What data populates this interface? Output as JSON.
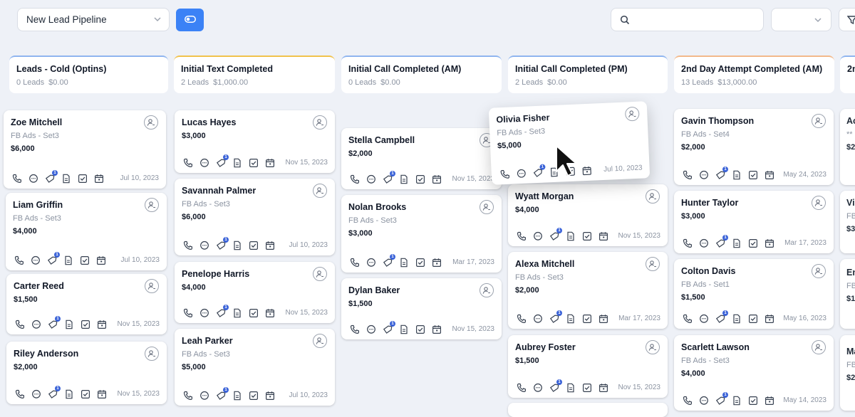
{
  "toolbar": {
    "pipeline_select": "New Lead Pipeline",
    "search_placeholder": "",
    "filter_select_value": ""
  },
  "colors": {
    "accent": "#3b82f6",
    "badge": "#3b63d8",
    "column_border": "#8fb5ef"
  },
  "columns": [
    {
      "title": "Leads - Cold (Optins)",
      "count": "0 Leads",
      "value": "$0.00"
    },
    {
      "title": "Initial Text Completed",
      "count": "2 Leads",
      "value": "$1,000.00"
    },
    {
      "title": "Initial Call Completed (AM)",
      "count": "0 Leads",
      "value": "$0.00"
    },
    {
      "title": "Initial Call Completed (PM)",
      "count": "2 Leads",
      "value": "$0.00"
    },
    {
      "title": "2nd Day Attempt Completed (AM)",
      "count": "13 Leads",
      "value": "$13,000.00"
    },
    {
      "title": "2n",
      "count": "",
      "value": ""
    }
  ],
  "cards": [
    {
      "name": "Zoe Mitchell",
      "source": "FB Ads - Set3",
      "amount": "$6,000",
      "date": "Jul 10, 2023"
    },
    {
      "name": "Liam Griffin",
      "source": "FB Ads - Set3",
      "amount": "$4,000",
      "date": "Jul 10, 2023"
    },
    {
      "name": "Carter Reed",
      "source": "",
      "amount": "$1,500",
      "date": "Nov 15, 2023"
    },
    {
      "name": "Riley Anderson",
      "source": "",
      "amount": "$2,000",
      "date": "Nov 15, 2023"
    },
    {
      "name": "Lucas Hayes",
      "source": "",
      "amount": "$3,000",
      "date": "Nov 15, 2023"
    },
    {
      "name": "Savannah Palmer",
      "source": "FB Ads - Set3",
      "amount": "$6,000",
      "date": "Jul 10, 2023"
    },
    {
      "name": "Penelope Harris",
      "source": "",
      "amount": "$4,000",
      "date": "Nov 15, 2023"
    },
    {
      "name": "Leah Parker",
      "source": "FB Ads - Set3",
      "amount": "$5,000",
      "date": "Jul 10, 2023"
    },
    {
      "name": "Stella Campbell",
      "source": "",
      "amount": "$2,000",
      "date": "Nov 15, 2023"
    },
    {
      "name": "Nolan Brooks",
      "source": "FB Ads - Set3",
      "amount": "$3,000",
      "date": "Mar 17, 2023"
    },
    {
      "name": "Dylan Baker",
      "source": "",
      "amount": "$1,500",
      "date": "Nov 15, 2023"
    },
    {
      "name": "Olivia Fisher",
      "source": "FB Ads - Set3",
      "amount": "$5,000",
      "date": "Jul 10, 2023"
    },
    {
      "name": "Wyatt Morgan",
      "source": "",
      "amount": "$4,000",
      "date": "Nov 15, 2023"
    },
    {
      "name": "Alexa Mitchell",
      "source": "FB Ads - Set3",
      "amount": "$2,000",
      "date": "Mar 17, 2023"
    },
    {
      "name": "Aubrey Foster",
      "source": "",
      "amount": "$1,500",
      "date": "Nov 15, 2023"
    },
    {
      "name": "Gavin Thompson",
      "source": "FB Ads - Set4",
      "amount": "$2,000",
      "date": "May 24, 2023"
    },
    {
      "name": "Hunter Taylor",
      "source": "",
      "amount": "$3,000",
      "date": "Mar 17, 2023"
    },
    {
      "name": "Colton Davis",
      "source": "FB Ads - Set1",
      "amount": "$1,500",
      "date": "May 16, 2023"
    },
    {
      "name": "Scarlett Lawson",
      "source": "FB Ads - Set3",
      "amount": "$4,000",
      "date": "May 14, 2023"
    }
  ],
  "edge_cards": [
    {
      "name": "Ac",
      "source": "**",
      "amount": "$2"
    },
    {
      "name": "Vi",
      "source": "FB",
      "amount": "$3"
    },
    {
      "name": "En",
      "source": "FB",
      "amount": "$1"
    },
    {
      "name": "Ma",
      "source": "FB",
      "amount": "$2"
    }
  ],
  "icons": {
    "card_actions": [
      "phone-icon",
      "chat-icon",
      "tag-icon",
      "document-icon",
      "checkbox-icon",
      "calendar-icon"
    ],
    "badge_count": "1"
  }
}
